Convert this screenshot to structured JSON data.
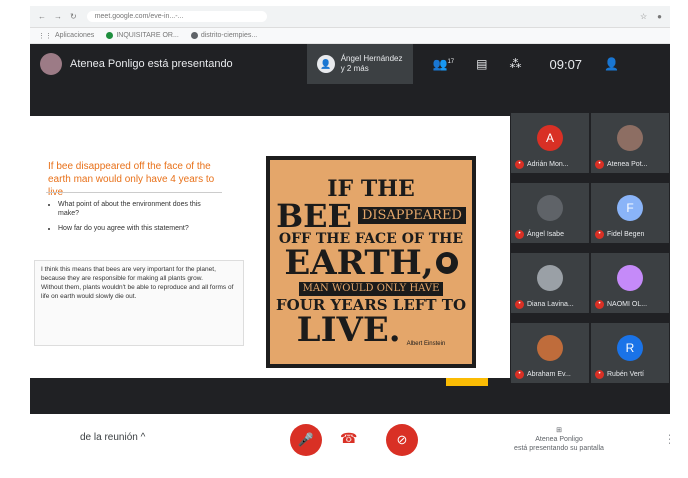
{
  "browser": {
    "url": "meet.google.com/eve-in...-...",
    "bookmarks": [
      {
        "label": "Aplicaciones"
      },
      {
        "label": "INQUISITARE OR..."
      },
      {
        "label": "distrito-ciempies..."
      }
    ]
  },
  "header": {
    "presenter_text": "Atenea Ponligo está presentando",
    "speaker_text": "Ángel Hernández\ny 2 más",
    "participant_count": "17",
    "clock": "09:07"
  },
  "slide": {
    "question": "If bee disappeared off the face of the earth man would only have 4 years to live",
    "bullets": [
      "What point of about the environment does this make?",
      "How far do you agree with this statement?"
    ],
    "answer": "I think this means that bees are very important for the planet, because they are responsible for making all plants grow.\nWithout them, plants wouldn't be able to reproduce and all forms of life on earth would slowly die out.",
    "poster": {
      "l1": "IF THE",
      "l2a": "BEE",
      "l2b": "DISAPPEARED",
      "l3": "OFF THE FACE OF THE",
      "l4": "EARTH,",
      "l5": "MAN WOULD ONLY HAVE",
      "l6": "FOUR YEARS LEFT TO",
      "l7": "LIVE.",
      "author": "Albert Einstein"
    }
  },
  "participants": [
    {
      "initial": "A",
      "name": "Adrián Mon...",
      "color": "#d93025"
    },
    {
      "initial": "",
      "name": "Atenea Pot...",
      "color": "#8d6e63"
    },
    {
      "initial": "",
      "name": "Ángel Isabe",
      "color": "#5f6368"
    },
    {
      "initial": "F",
      "name": "Fidel Begen",
      "color": "#8ab4f8"
    },
    {
      "initial": "",
      "name": "Diana Lavina...",
      "color": "#9aa0a6"
    },
    {
      "initial": "",
      "name": "NAOMI OL...",
      "color": "#c58af9"
    },
    {
      "initial": "",
      "name": "Abraham Ev...",
      "color": "#bf6c3b"
    },
    {
      "initial": "R",
      "name": "Rubén Vertí",
      "color": "#1a73e8"
    }
  ],
  "controls": {
    "meeting_details": "de la reunión ^",
    "present_label": "Atenea Ponligo\nestá presentando su pantalla"
  },
  "icons": [
    "mic-off-icon",
    "hang-up-icon",
    "camera-off-icon",
    "people-icon",
    "chat-icon",
    "activities-icon",
    "more-icon",
    "present-icon"
  ]
}
